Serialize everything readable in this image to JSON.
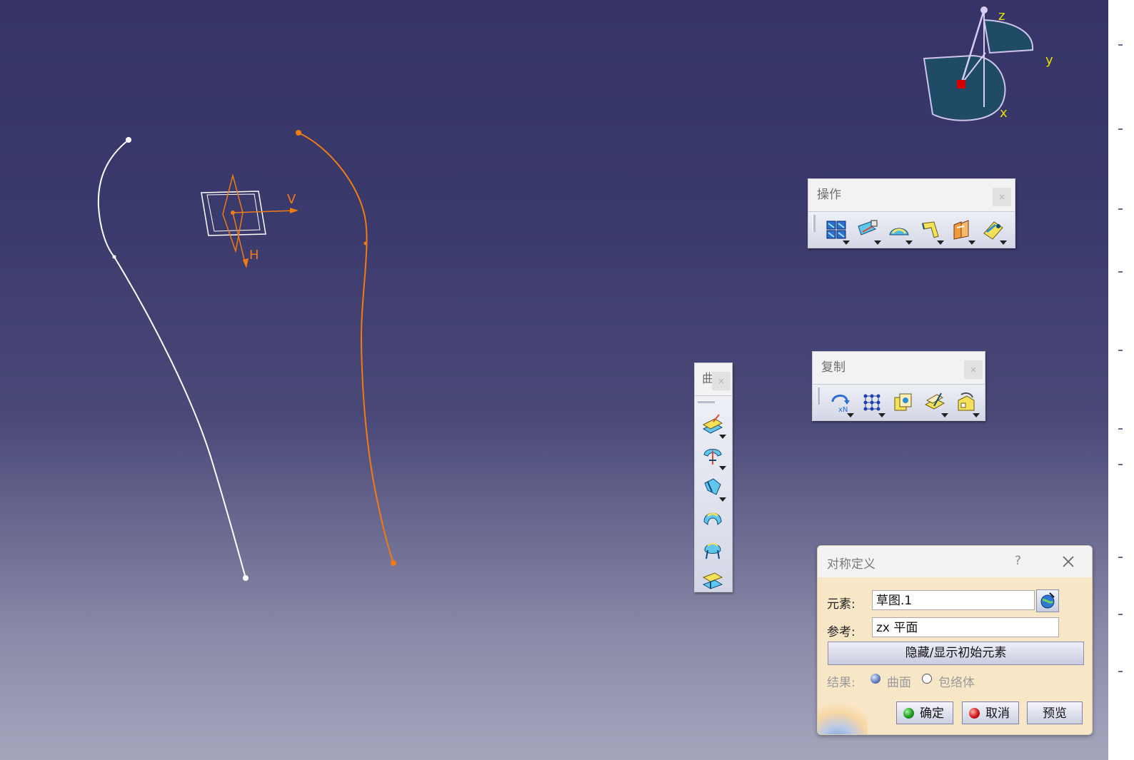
{
  "viewport": {
    "sketch_label_v": "V",
    "sketch_label_h": "H",
    "compass_z": "z",
    "compass_y": "y",
    "compass_x": "x"
  },
  "toolbar_operations": {
    "title": "操作",
    "close": "×",
    "tools": [
      {
        "icon": "join-icon",
        "has_dropdown": true
      },
      {
        "icon": "split-icon",
        "has_dropdown": true
      },
      {
        "icon": "fillet-icon",
        "has_dropdown": true
      },
      {
        "icon": "extrapolate-icon",
        "has_dropdown": true
      },
      {
        "icon": "translate-icon",
        "has_dropdown": true
      },
      {
        "icon": "extract-icon",
        "has_dropdown": true
      }
    ]
  },
  "toolbar_copy": {
    "title": "复制",
    "close": "×",
    "tools": [
      {
        "icon": "repetition-icon",
        "has_dropdown": true
      },
      {
        "icon": "pattern-icon",
        "has_dropdown": true
      },
      {
        "icon": "powercopy-icon",
        "has_dropdown": false
      },
      {
        "icon": "instantiate-icon",
        "has_dropdown": true
      },
      {
        "icon": "catalog-icon",
        "has_dropdown": true
      }
    ]
  },
  "toolbar_surfaces": {
    "title": "曲",
    "close": "×",
    "tools": [
      {
        "icon": "extrude-icon",
        "has_dropdown": true
      },
      {
        "icon": "revolve-icon",
        "has_dropdown": true
      },
      {
        "icon": "offset-icon",
        "has_dropdown": true
      },
      {
        "icon": "sweep-icon",
        "has_dropdown": false
      },
      {
        "icon": "multisection-icon",
        "has_dropdown": false
      },
      {
        "icon": "blend-icon",
        "has_dropdown": false
      }
    ]
  },
  "dialog": {
    "title": "对称定义",
    "help": "?",
    "element_label": "元素:",
    "element_value": "草图.1",
    "reference_label": "参考:",
    "reference_value": "zx 平面",
    "hide_show_button": "隐藏/显示初始元素",
    "result_label": "结果:",
    "result_options": [
      "曲面",
      "包络体"
    ],
    "result_selected": "曲面",
    "ok_button": "确定",
    "cancel_button": "取消",
    "preview_button": "预览",
    "colors": {
      "ok_led": "#1c9a1c",
      "cancel_led": "#d01818",
      "background": "#f8e7c7"
    }
  }
}
